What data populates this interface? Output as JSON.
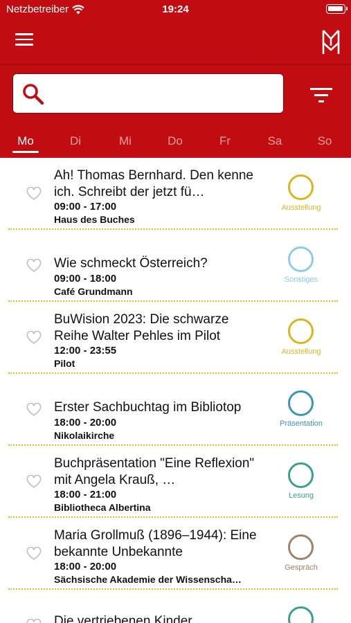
{
  "status_bar": {
    "carrier": "Netzbetreiber",
    "time": "19:24"
  },
  "header": {
    "menu_icon": "hamburger-icon",
    "logo_icon": "double-m-logo-icon",
    "filter_icon": "filter-icon"
  },
  "search": {
    "value": "",
    "placeholder": ""
  },
  "days": [
    {
      "label": "Mo",
      "active": true
    },
    {
      "label": "Di",
      "active": false
    },
    {
      "label": "Mi",
      "active": false
    },
    {
      "label": "Do",
      "active": false
    },
    {
      "label": "Fr",
      "active": false
    },
    {
      "label": "Sa",
      "active": false
    },
    {
      "label": "So",
      "active": false
    }
  ],
  "category_colors": {
    "Ausstellung": "#dcb51b",
    "Sonstiges": "#8ecbe8",
    "Präsentation": "#3f93b8",
    "Lesung": "#3aa08c",
    "Gespräch": "#9b8468"
  },
  "events": [
    {
      "title": "Ah! Thomas Bernhard. Den kenne ich. Schreibt der jetzt fü…",
      "time": "09:00 - 17:00",
      "place": "Haus des Buches",
      "category": "Ausstellung"
    },
    {
      "title": "Wie schmeckt Österreich?",
      "time": "09:00 - 18:00",
      "place": "Café Grundmann",
      "category": "Sonstiges"
    },
    {
      "title": "BuWision 2023: Die schwarze Reihe Walter Pehles im Pilot",
      "time": "12:00 - 23:55",
      "place": "Pilot",
      "category": "Ausstellung"
    },
    {
      "title": "Erster Sachbuchtag im Bibliotop",
      "time": "18:00 - 20:00",
      "place": "Nikolaikirche",
      "category": "Präsentation"
    },
    {
      "title": "Buchpräsentation \"Eine Reflexion\" mit Angela Krauß, …",
      "time": "18:00 - 21:00",
      "place": "Bibliotheca Albertina",
      "category": "Lesung"
    },
    {
      "title": "Maria Grollmuß (1896–1944): Eine bekannte Unbekannte",
      "time": "18:00 - 20:00",
      "place": "Sächsische Akademie der Wissenscha…",
      "category": "Gespräch"
    },
    {
      "title": "Die vertriebenen Kinder",
      "time": "",
      "place": "",
      "category": "Lesung"
    }
  ]
}
